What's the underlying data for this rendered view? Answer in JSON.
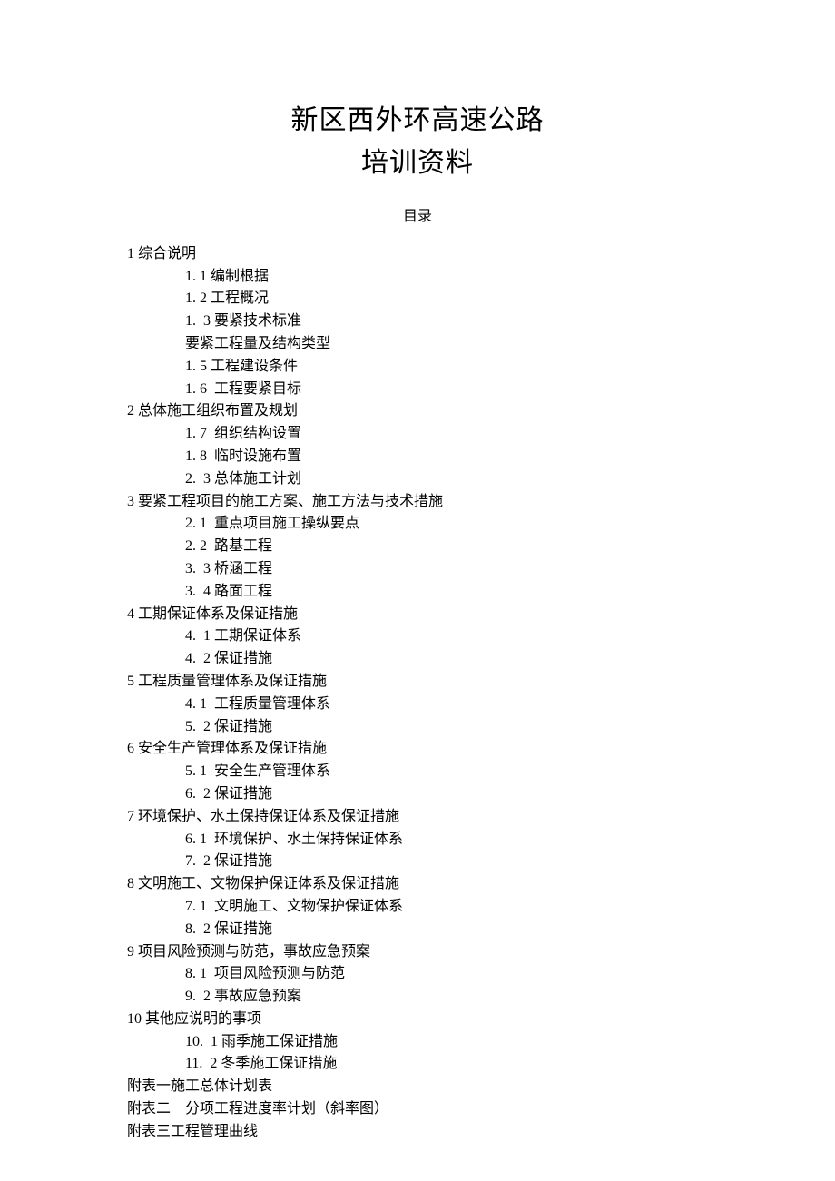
{
  "title": {
    "line1": "新区西外环高速公路",
    "line2": "培训资料"
  },
  "toc_label": "目录",
  "toc": [
    {
      "indent": 0,
      "text": "1 综合说明"
    },
    {
      "indent": 1,
      "text": "1. 1 编制根据"
    },
    {
      "indent": 1,
      "text": "1. 2 工程概况"
    },
    {
      "indent": 1,
      "text": "1.  3 要紧技术标准"
    },
    {
      "indent": 1,
      "text": "要紧工程量及结构类型"
    },
    {
      "indent": 1,
      "text": "1. 5 工程建设条件"
    },
    {
      "indent": 1,
      "text": "1. 6  工程要紧目标"
    },
    {
      "indent": 0,
      "text": "2 总体施工组织布置及规划"
    },
    {
      "indent": 1,
      "text": "1. 7  组织结构设置"
    },
    {
      "indent": 1,
      "text": "1. 8  临时设施布置"
    },
    {
      "indent": 1,
      "text": "2.  3 总体施工计划"
    },
    {
      "indent": 0,
      "text": "3 要紧工程项目的施工方案、施工方法与技术措施"
    },
    {
      "indent": 1,
      "text": "2. 1  重点项目施工操纵要点"
    },
    {
      "indent": 1,
      "text": "2. 2  路基工程"
    },
    {
      "indent": 1,
      "text": "3.  3 桥涵工程"
    },
    {
      "indent": 1,
      "text": "3.  4 路面工程"
    },
    {
      "indent": 0,
      "text": "4 工期保证体系及保证措施"
    },
    {
      "indent": 1,
      "text": "4.  1 工期保证体系"
    },
    {
      "indent": 1,
      "text": "4.  2 保证措施"
    },
    {
      "indent": 0,
      "text": "5 工程质量管理体系及保证措施"
    },
    {
      "indent": 1,
      "text": "4. 1  工程质量管理体系"
    },
    {
      "indent": 1,
      "text": "5.  2 保证措施"
    },
    {
      "indent": 0,
      "text": "6 安全生产管理体系及保证措施"
    },
    {
      "indent": 1,
      "text": "5. 1  安全生产管理体系"
    },
    {
      "indent": 1,
      "text": "6.  2 保证措施"
    },
    {
      "indent": 0,
      "text": "7 环境保护、水土保持保证体系及保证措施"
    },
    {
      "indent": 1,
      "text": "6. 1  环境保护、水土保持保证体系"
    },
    {
      "indent": 1,
      "text": "7.  2 保证措施"
    },
    {
      "indent": 0,
      "text": "8 文明施工、文物保护保证体系及保证措施"
    },
    {
      "indent": 1,
      "text": "7. 1  文明施工、文物保护保证体系"
    },
    {
      "indent": 1,
      "text": "8.  2 保证措施"
    },
    {
      "indent": 0,
      "text": "9 项目风险预测与防范，事故应急预案"
    },
    {
      "indent": 1,
      "text": "8. 1  项目风险预测与防范"
    },
    {
      "indent": 1,
      "text": "9.  2 事故应急预案"
    },
    {
      "indent": 0,
      "text": "10 其他应说明的事项"
    },
    {
      "indent": 1,
      "text": "10.  1 雨季施工保证措施"
    },
    {
      "indent": 1,
      "text": "11.  2 冬季施工保证措施"
    },
    {
      "indent": 0,
      "text": "附表一施工总体计划表"
    },
    {
      "indent": 0,
      "text": "附表二    分项工程进度率计划（斜率图）"
    },
    {
      "indent": 0,
      "text": "附表三工程管理曲线"
    }
  ]
}
